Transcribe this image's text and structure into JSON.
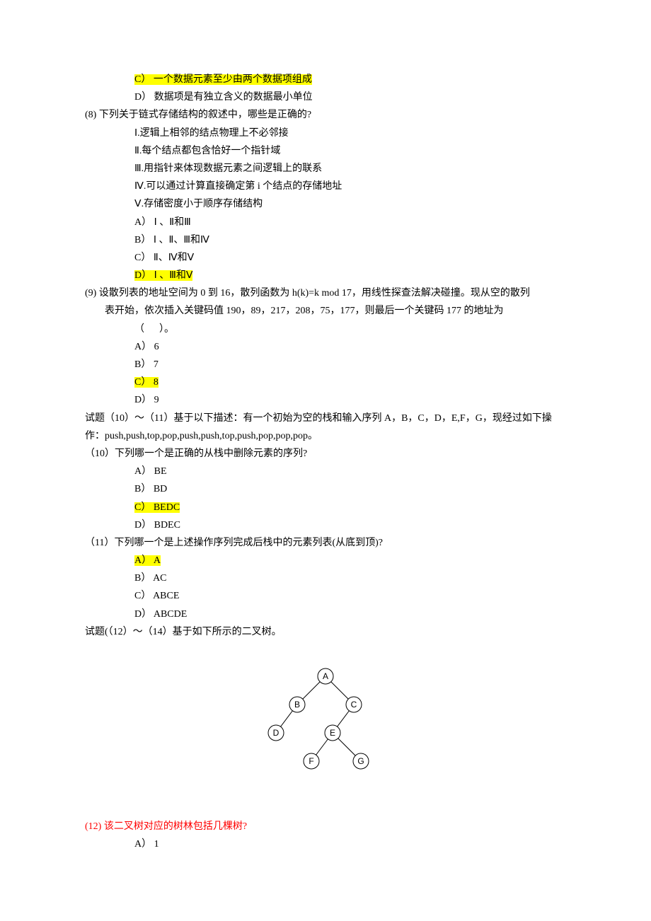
{
  "q7": {
    "optC": "C） 一个数据元素至少由两个数据项组成",
    "optD": "D） 数据项是有独立含义的数据最小单位"
  },
  "q8": {
    "stem": "(8) 下列关于链式存储结构的叙述中，哪些是正确的?",
    "i": "Ⅰ.逻辑上相邻的结点物理上不必邻接",
    "ii": "Ⅱ.每个结点都包含恰好一个指针域",
    "iii": "Ⅲ.用指针来体现数据元素之间逻辑上的联系",
    "iv": "Ⅳ.可以通过计算直接确定第 i 个结点的存储地址",
    "v": "Ⅴ.存储密度小于顺序存储结构",
    "optA": "A） Ⅰ 、Ⅱ和Ⅲ",
    "optB": "B） Ⅰ 、Ⅱ、Ⅲ和Ⅳ",
    "optC": "C） Ⅱ、Ⅳ和Ⅴ",
    "optD": "D） Ⅰ 、Ⅲ和Ⅴ"
  },
  "q9": {
    "stem1": "(9) 设散列表的地址空间为 0 到 16，散列函数为 h(k)=k mod 17，用线性探查法解决碰撞。现从空的散列",
    "stem2": "表开始，依次插入关键码值 190，89，217，208，75，177，则最后一个关键码 177 的地址为",
    "blank": "（      ）。",
    "optA": "A） 6",
    "optB": "B） 7",
    "optC": "C） 8",
    "optD": "D） 9"
  },
  "desc1": {
    "l1": "试题（10）～（11）基于以下描述：有一个初始为空的栈和输入序列 A，B，C，D，E,F，G，现经过如下操",
    "l2": "作：push,push,top,pop,push,push,top,push,pop,pop,pop。"
  },
  "q10": {
    "stem": "（10）下列哪一个是正确的从栈中删除元素的序列?",
    "optA": "A） BE",
    "optB": "B） BD",
    "optC": "C） BEDC",
    "optD": "D） BDEC"
  },
  "q11": {
    "stem": "（11）下列哪一个是上述操作序列完成后栈中的元素列表(从底到顶)?",
    "optA": "A） A",
    "optB": "B） AC",
    "optC": "C） ABCE",
    "optD": "D） ABCDE"
  },
  "desc2": "试题(（12）～（14）基于如下所示的二叉树。",
  "tree": {
    "A": "A",
    "B": "B",
    "C": "C",
    "D": "D",
    "E": "E",
    "F": "F",
    "G": "G"
  },
  "q12": {
    "stem": "(12) 该二叉树对应的树林包括几棵树?",
    "optA": "A） 1"
  }
}
